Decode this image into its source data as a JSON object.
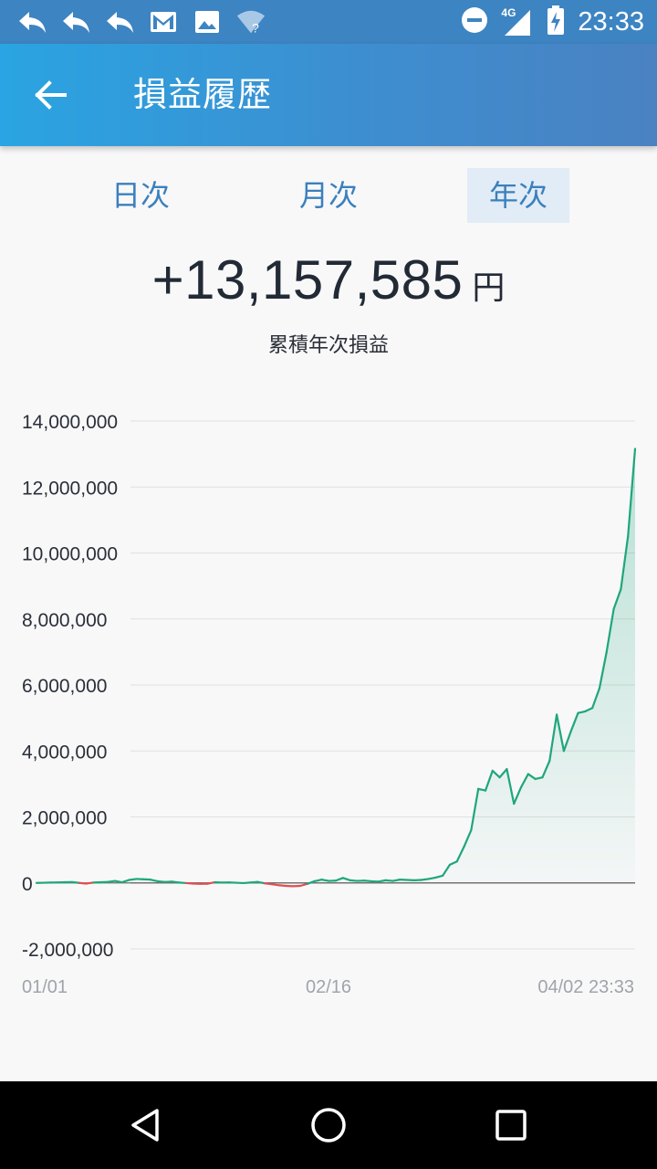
{
  "status_bar": {
    "time": "23:33",
    "network_label": "4G",
    "left_icons": [
      "reply-icon",
      "reply-icon",
      "reply-icon",
      "gmail-icon",
      "image-icon",
      "wifi-question-icon"
    ],
    "right_icons": [
      "do-not-disturb-icon",
      "signal-4g-icon",
      "battery-charging-icon"
    ]
  },
  "appbar": {
    "title": "損益履歴"
  },
  "tabs": [
    {
      "label": "日次",
      "active": false
    },
    {
      "label": "月次",
      "active": false
    },
    {
      "label": "年次",
      "active": true
    }
  ],
  "summary": {
    "value": "+13,157,585",
    "unit": "円",
    "caption": "累積年次損益"
  },
  "colors": {
    "positive": "#1fa67a",
    "negative": "#e05050",
    "grid": "#e0e0e0",
    "accent": "#3b80bd"
  },
  "chart_data": {
    "type": "line",
    "ylim": [
      -2000000,
      14000000
    ],
    "y_ticks": [
      14000000,
      12000000,
      10000000,
      8000000,
      6000000,
      4000000,
      2000000,
      0,
      -2000000
    ],
    "y_tick_labels": [
      "14,000,000",
      "12,000,000",
      "10,000,000",
      "8,000,000",
      "6,000,000",
      "4,000,000",
      "2,000,000",
      "0",
      "-2,000,000"
    ],
    "x_tick_labels": [
      "01/01",
      "02/16",
      "04/02 23:33"
    ],
    "grid": true,
    "area_fill": true,
    "series": [
      {
        "values": [
          0,
          5000,
          10000,
          15000,
          20000,
          25000,
          0,
          -20000,
          10000,
          20000,
          30000,
          60000,
          20000,
          90000,
          120000,
          110000,
          100000,
          50000,
          30000,
          40000,
          10000,
          -5000,
          -20000,
          -30000,
          -25000,
          20000,
          10000,
          15000,
          5000,
          -5000,
          10000,
          30000,
          -10000,
          -40000,
          -70000,
          -90000,
          -100000,
          -90000,
          -30000,
          50000,
          100000,
          60000,
          70000,
          150000,
          80000,
          60000,
          70000,
          50000,
          40000,
          80000,
          60000,
          100000,
          90000,
          80000,
          90000,
          120000,
          160000,
          220000,
          550000,
          650000,
          1100000,
          1600000,
          2850000,
          2800000,
          3400000,
          3200000,
          3450000,
          2400000,
          2900000,
          3300000,
          3150000,
          3200000,
          3700000,
          5100000,
          4000000,
          4600000,
          5150000,
          5200000,
          5300000,
          5900000,
          7000000,
          8300000,
          8900000,
          10500000,
          13157585
        ]
      }
    ]
  }
}
